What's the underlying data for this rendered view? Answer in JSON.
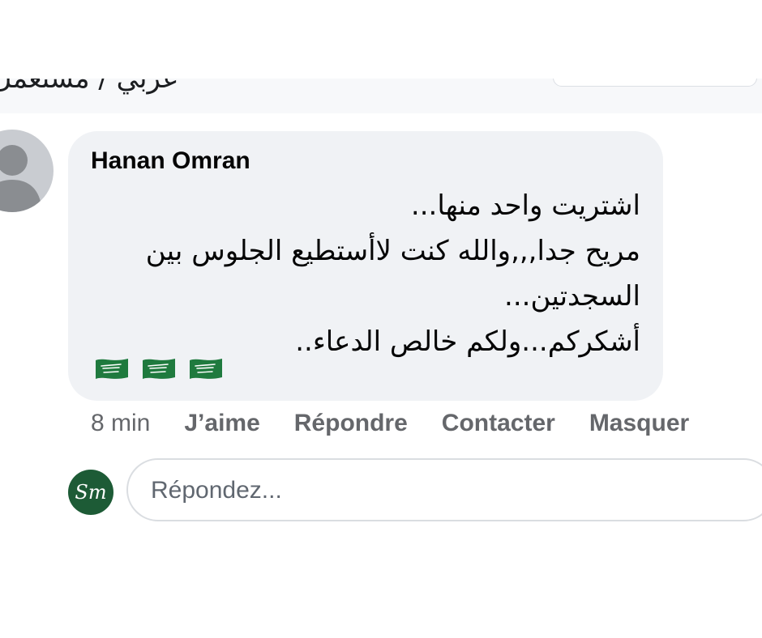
{
  "previous_post": {
    "fragment_text": "عربي / مستعمل"
  },
  "comment": {
    "author": "Hanan Omran",
    "body_lines": [
      "اشتريت واحد منها...",
      "مريح جدا,,,والله كنت لاأستطيع الجلوس بين",
      "السجدتين...",
      "أشكركم...ولكم خالص الدعاء.."
    ],
    "emoji_flags": [
      "saudi-flag",
      "saudi-flag",
      "saudi-flag"
    ],
    "colors": {
      "bubble": "#f0f2f5",
      "flag_green": "#1f7a3e"
    }
  },
  "actions": {
    "time": "8 min",
    "like": "J’aime",
    "reply": "Répondre",
    "contact": "Contacter",
    "hide": "Masquer"
  },
  "reply_box": {
    "avatar_monogram": "Sm",
    "placeholder": "Répondez..."
  }
}
